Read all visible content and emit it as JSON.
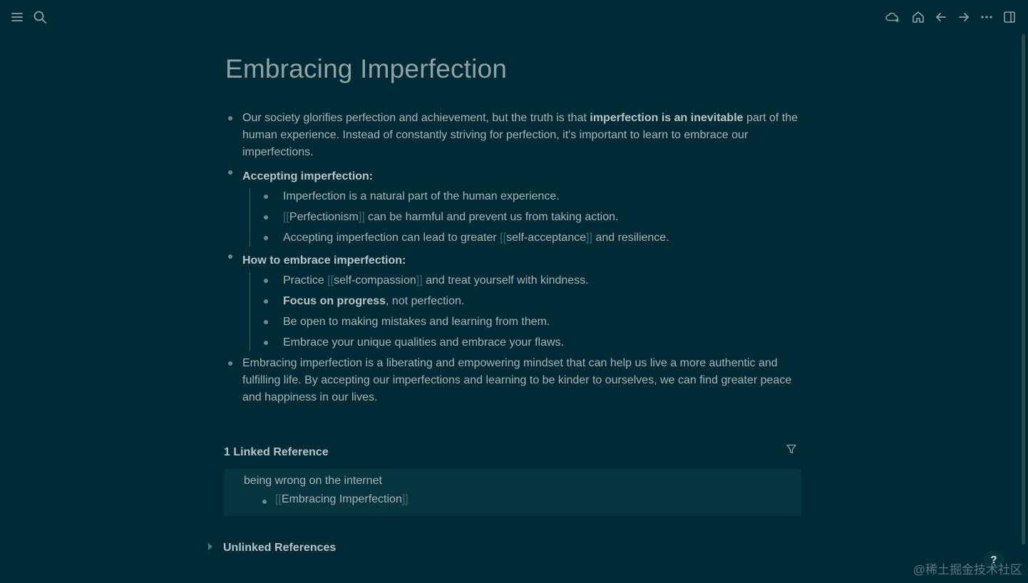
{
  "topbar": {
    "left_icons": [
      "menu-icon",
      "search-icon"
    ],
    "right_icons": [
      "cloud-sync-icon",
      "home-icon",
      "back-arrow-icon",
      "forward-arrow-icon",
      "more-icon",
      "sidebar-toggle-icon"
    ],
    "sync_status_color": "#2ecc71"
  },
  "page": {
    "title": "Embracing Imperfection",
    "blocks": [
      {
        "text_before": "Our society glorifies perfection and achievement, but the truth is that ",
        "bold": "imperfection is an inevitable",
        "text_after": " part of the human experience. Instead of constantly striving for perfection, it's important to learn to embrace our imperfections."
      },
      {
        "heading": "Accepting imperfection:",
        "children": [
          {
            "text": "Imperfection is a natural part of the human experience."
          },
          {
            "ref": "Perfectionism",
            "after": " can be harmful and prevent us from taking action."
          },
          {
            "before": "Accepting imperfection can lead to greater ",
            "ref": "self-acceptance",
            "after": " and resilience."
          }
        ]
      },
      {
        "heading": "How to embrace imperfection:",
        "children": [
          {
            "before": "Practice ",
            "ref": "self-compassion",
            "after": " and treat yourself with kindness."
          },
          {
            "bold": "Focus on progress",
            "after": ", not perfection."
          },
          {
            "text": "Be open to making mistakes and learning from them."
          },
          {
            "text": "Embrace your unique qualities and embrace your flaws."
          }
        ]
      },
      {
        "text": "Embracing imperfection is a liberating and empowering mindset that can help us live a more authentic and fulfilling life. By accepting our imperfections and learning to be kinder to ourselves, we can find greater peace and happiness in our lives."
      }
    ]
  },
  "references": {
    "linked_header": "1 Linked Reference",
    "linked_page": "being wrong on the internet",
    "linked_child_ref": "Embracing Imperfection",
    "unlinked_header": "Unlinked References"
  },
  "help_label": "?",
  "watermark": "@稀土掘金技术社区",
  "brackets": {
    "open": "[[",
    "close": "]]"
  }
}
